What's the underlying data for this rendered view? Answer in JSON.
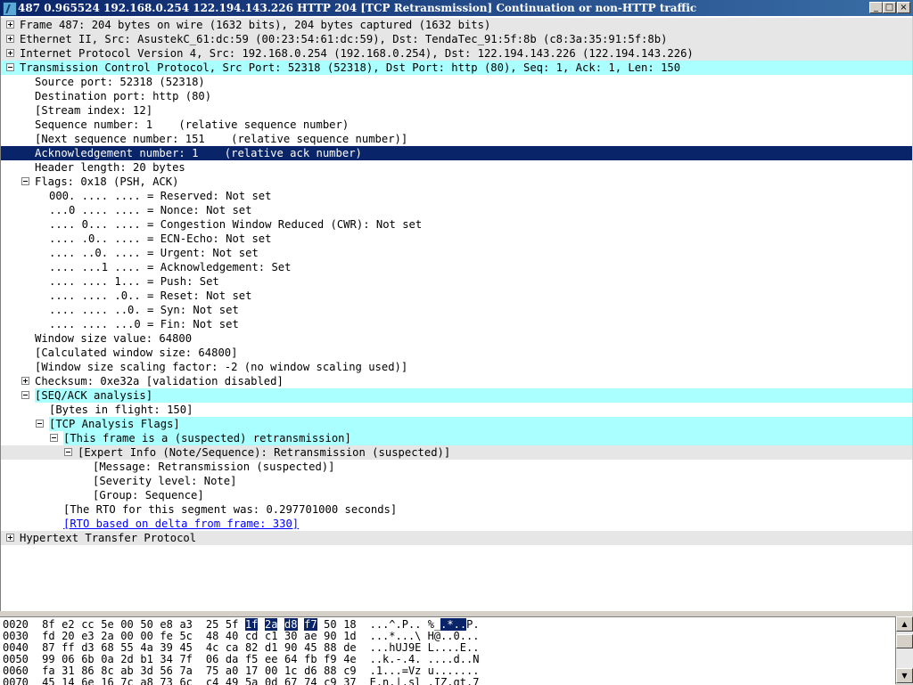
{
  "window": {
    "title": "487 0.965524 192.168.0.254 122.194.143.226 HTTP 204 [TCP Retransmission] Continuation or non-HTTP traffic",
    "buttons": {
      "minimize": "_",
      "maximize": "□",
      "close": "×"
    }
  },
  "tree": [
    {
      "text": "Frame 487: 204 bytes on wire (1632 bits), 204 bytes captured (1632 bits)",
      "level": 0,
      "expander": "plus",
      "style": "gray"
    },
    {
      "text": "Ethernet II, Src: AsustekC_61:dc:59 (00:23:54:61:dc:59), Dst: TendaTec_91:5f:8b (c8:3a:35:91:5f:8b)",
      "level": 0,
      "expander": "plus",
      "style": "gray"
    },
    {
      "text": "Internet Protocol Version 4, Src: 192.168.0.254 (192.168.0.254), Dst: 122.194.143.226 (122.194.143.226)",
      "level": 0,
      "expander": "plus",
      "style": "gray"
    },
    {
      "text": "Transmission Control Protocol, Src Port: 52318 (52318), Dst Port: http (80), Seq: 1, Ack: 1, Len: 150",
      "level": 0,
      "expander": "minus",
      "style": "cyan"
    },
    {
      "text": "Source port: 52318 (52318)",
      "level": 1
    },
    {
      "text": "Destination port: http (80)",
      "level": 1
    },
    {
      "text": "[Stream index: 12]",
      "level": 1
    },
    {
      "text": "Sequence number: 1    (relative sequence number)",
      "level": 1
    },
    {
      "text": "[Next sequence number: 151    (relative sequence number)]",
      "level": 1
    },
    {
      "text": "Acknowledgement number: 1    (relative ack number)",
      "level": 1,
      "style": "selected"
    },
    {
      "text": "Header length: 20 bytes",
      "level": 1
    },
    {
      "text": "Flags: 0x18 (PSH, ACK)",
      "level": 1,
      "expander": "minus"
    },
    {
      "text": "000. .... .... = Reserved: Not set",
      "level": 2
    },
    {
      "text": "...0 .... .... = Nonce: Not set",
      "level": 2
    },
    {
      "text": ".... 0... .... = Congestion Window Reduced (CWR): Not set",
      "level": 2
    },
    {
      "text": ".... .0.. .... = ECN-Echo: Not set",
      "level": 2
    },
    {
      "text": ".... ..0. .... = Urgent: Not set",
      "level": 2
    },
    {
      "text": ".... ...1 .... = Acknowledgement: Set",
      "level": 2
    },
    {
      "text": ".... .... 1... = Push: Set",
      "level": 2
    },
    {
      "text": ".... .... .0.. = Reset: Not set",
      "level": 2
    },
    {
      "text": ".... .... ..0. = Syn: Not set",
      "level": 2
    },
    {
      "text": ".... .... ...0 = Fin: Not set",
      "level": 2
    },
    {
      "text": "Window size value: 64800",
      "level": 1
    },
    {
      "text": "[Calculated window size: 64800]",
      "level": 1
    },
    {
      "text": "[Window size scaling factor: -2 (no window scaling used)]",
      "level": 1
    },
    {
      "text": "Checksum: 0xe32a [validation disabled]",
      "level": 1,
      "expander": "plus"
    },
    {
      "text": "[SEQ/ACK analysis]",
      "level": 1,
      "expander": "minus",
      "style": "cyan"
    },
    {
      "text": "[Bytes in flight: 150]",
      "level": 2
    },
    {
      "text": "[TCP Analysis Flags]",
      "level": 2,
      "expander": "minus",
      "style": "cyan"
    },
    {
      "text": "[This frame is a (suspected) retransmission]",
      "level": 3,
      "expander": "minus",
      "style": "cyan"
    },
    {
      "text": "[Expert Info (Note/Sequence): Retransmission (suspected)]",
      "level": 4,
      "expander": "minus",
      "style": "gray"
    },
    {
      "text": "[Message: Retransmission (suspected)]",
      "level": 5
    },
    {
      "text": "[Severity level: Note]",
      "level": 5
    },
    {
      "text": "[Group: Sequence]",
      "level": 5
    },
    {
      "text": "[The RTO for this segment was: 0.297701000 seconds]",
      "level": 3
    },
    {
      "text": "[RTO based on delta from frame: 330]",
      "level": 3,
      "style": "link"
    },
    {
      "text": "Hypertext Transfer Protocol",
      "level": 0,
      "expander": "plus",
      "style": "gray"
    }
  ],
  "hex": [
    {
      "offset": "0020",
      "g1": [
        "8f",
        "e2",
        "cc",
        "5e",
        "00",
        "50",
        "e8",
        "a3"
      ],
      "g2": [
        "25",
        "5f",
        "1f",
        "2a",
        "d8",
        "f7",
        "50",
        "18"
      ],
      "ascii": "...^.P.. %_.*..P.",
      "sel_bytes": [
        10,
        11,
        12,
        13
      ],
      "sel_ascii": [
        11,
        12,
        13,
        14
      ]
    },
    {
      "offset": "0030",
      "g1": [
        "fd",
        "20",
        "e3",
        "2a",
        "00",
        "00",
        "fe",
        "5c"
      ],
      "g2": [
        "48",
        "40",
        "cd",
        "c1",
        "30",
        "ae",
        "90",
        "1d"
      ],
      "ascii": "...*...\\ H@..0...",
      "sel_bytes": [],
      "sel_ascii": []
    },
    {
      "offset": "0040",
      "g1": [
        "87",
        "ff",
        "d3",
        "68",
        "55",
        "4a",
        "39",
        "45"
      ],
      "g2": [
        "4c",
        "ca",
        "82",
        "d1",
        "90",
        "45",
        "88",
        "de"
      ],
      "ascii": "...hUJ9E L....E..",
      "sel_bytes": [],
      "sel_ascii": []
    },
    {
      "offset": "0050",
      "g1": [
        "99",
        "06",
        "6b",
        "0a",
        "2d",
        "b1",
        "34",
        "7f"
      ],
      "g2": [
        "06",
        "da",
        "f5",
        "ee",
        "64",
        "fb",
        "f9",
        "4e"
      ],
      "ascii": "..k.-.4. ....d..N",
      "sel_bytes": [],
      "sel_ascii": []
    },
    {
      "offset": "0060",
      "g1": [
        "fa",
        "31",
        "86",
        "8c",
        "ab",
        "3d",
        "56",
        "7a"
      ],
      "g2": [
        "75",
        "a0",
        "17",
        "00",
        "1c",
        "d6",
        "88",
        "c9"
      ],
      "ascii": ".1...=Vz u.......",
      "sel_bytes": [],
      "sel_ascii": []
    },
    {
      "offset": "0070",
      "g1": [
        "45",
        "14",
        "6e",
        "16",
        "7c",
        "a8",
        "73",
        "6c"
      ],
      "g2": [
        "c4",
        "49",
        "5a",
        "0d",
        "67",
        "74",
        "c9",
        "37"
      ],
      "ascii": "E.n.|.sl .IZ.gt.7",
      "sel_bytes": [],
      "sel_ascii": []
    }
  ],
  "scrollbar": {
    "up": "▲",
    "down": "▼"
  },
  "colors": {
    "title_start": "#0a246a",
    "title_end": "#3a6ea5",
    "cyan_highlight": "#aaffff",
    "gray_highlight": "#e6e6e6",
    "selection": "#0a246a",
    "link": "#0000ff"
  }
}
